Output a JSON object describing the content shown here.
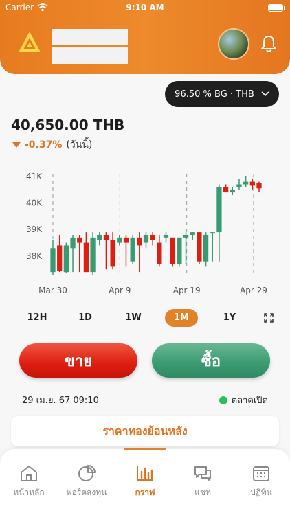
{
  "status_bar": {
    "carrier": "Carrier",
    "time": "9:10 AM"
  },
  "header": {
    "logo_icon": "gold-triangle-logo",
    "avatar_icon": "profile-avatar",
    "bell_icon": "bell-icon"
  },
  "selector": {
    "label": "96.50 % BG · THB",
    "icon": "chevron-down-icon"
  },
  "price": {
    "value": "40,650.00 THB",
    "change": "-0.37%",
    "period": "(วันนี้)",
    "direction_icon": "triangle-down-icon"
  },
  "colors": {
    "accent": "#e28228",
    "up": "#3a9a71",
    "down": "#dd1e10"
  },
  "chart_data": {
    "type": "candlestick",
    "y_ticks": [
      "41K",
      "40K",
      "39K",
      "38K"
    ],
    "x_ticks": [
      "Mar 30",
      "Apr 9",
      "Apr 19",
      "Apr 29"
    ],
    "ylim": [
      37300,
      41100
    ],
    "grid": "dashed vertical lines at x ticks",
    "candles": [
      {
        "o": 37400,
        "c": 38300,
        "h": 38600,
        "l": 37300
      },
      {
        "o": 38400,
        "c": 37450,
        "h": 38800,
        "l": 37400
      },
      {
        "o": 37400,
        "c": 38400,
        "h": 38500,
        "l": 37350
      },
      {
        "o": 38300,
        "c": 38700,
        "h": 38800,
        "l": 37400
      },
      {
        "o": 38700,
        "c": 38500,
        "h": 38800,
        "l": 37400
      },
      {
        "o": 38500,
        "c": 37400,
        "h": 38900,
        "l": 37400
      },
      {
        "o": 37400,
        "c": 38700,
        "h": 38900,
        "l": 37300
      },
      {
        "o": 38600,
        "c": 38800,
        "h": 38900,
        "l": 38400
      },
      {
        "o": 38800,
        "c": 38600,
        "h": 38900,
        "l": 37500
      },
      {
        "o": 38600,
        "c": 37600,
        "h": 38900,
        "l": 37500
      },
      {
        "o": 38500,
        "c": 38700,
        "h": 38800,
        "l": 38400
      },
      {
        "o": 38700,
        "c": 38500,
        "h": 38800,
        "l": 37600
      },
      {
        "o": 37800,
        "c": 38700,
        "h": 38800,
        "l": 37700
      },
      {
        "o": 38700,
        "c": 38400,
        "h": 38900,
        "l": 37400
      },
      {
        "o": 38500,
        "c": 38800,
        "h": 38900,
        "l": 38300
      },
      {
        "o": 38800,
        "c": 38600,
        "h": 38900,
        "l": 38400
      },
      {
        "o": 38500,
        "c": 37700,
        "h": 38800,
        "l": 37600
      },
      {
        "o": 38700,
        "c": 38800,
        "h": 38900,
        "l": 38500
      },
      {
        "o": 38700,
        "c": 37700,
        "h": 38700,
        "l": 37600
      },
      {
        "o": 37700,
        "c": 38700,
        "h": 38700,
        "l": 37600
      },
      {
        "o": 38700,
        "c": 38800,
        "h": 38900,
        "l": 37700
      },
      {
        "o": 38800,
        "c": 38900,
        "h": 38900,
        "l": 38600
      },
      {
        "o": 38900,
        "c": 37800,
        "h": 38900,
        "l": 37700
      },
      {
        "o": 37800,
        "c": 38800,
        "h": 38900,
        "l": 37600
      },
      {
        "o": 38900,
        "c": 38900,
        "h": 38900,
        "l": 37800
      },
      {
        "o": 38900,
        "c": 40600,
        "h": 40700,
        "l": 37800
      },
      {
        "o": 40600,
        "c": 40400,
        "h": 40700,
        "l": 40400
      },
      {
        "o": 40400,
        "c": 40500,
        "h": 40600,
        "l": 40300
      },
      {
        "o": 40600,
        "c": 40700,
        "h": 40900,
        "l": 40500
      },
      {
        "o": 40700,
        "c": 40800,
        "h": 41000,
        "l": 40600
      },
      {
        "o": 40800,
        "c": 40650,
        "h": 40900,
        "l": 40500
      },
      {
        "o": 40750,
        "c": 40550,
        "h": 40800,
        "l": 40400
      }
    ]
  },
  "ranges": [
    "12H",
    "1D",
    "1W",
    "1M",
    "1Y"
  ],
  "active_range": "1M",
  "actions": {
    "sell": "ขาย",
    "buy": "ซื้อ"
  },
  "info": {
    "datetime": "29 เม.ย. 67 09:10",
    "market_status": "ตลาดเปิด"
  },
  "history_button": "ราคาทองย้อนหลัง",
  "nav": [
    {
      "label": "หน้าหลัก",
      "icon": "home-icon"
    },
    {
      "label": "พอร์ตลงทุน",
      "icon": "pie-chart-icon"
    },
    {
      "label": "กราฟ",
      "icon": "bar-chart-icon"
    },
    {
      "label": "แชท",
      "icon": "chat-icon"
    },
    {
      "label": "ปฏิทิน",
      "icon": "calendar-icon"
    }
  ]
}
